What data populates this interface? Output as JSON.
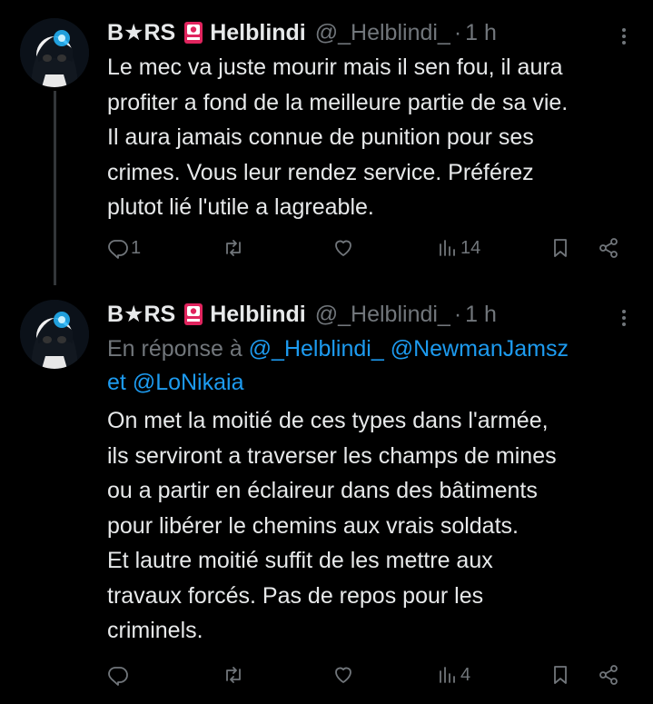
{
  "colors": {
    "background": "#000000",
    "text": "#e7e9ea",
    "muted": "#71767b",
    "link": "#1d9bf0",
    "thread_line": "#333639"
  },
  "tweets": [
    {
      "display_name": "B★RS",
      "badge_icon": "red-flag-icon",
      "name2": "Helblindi",
      "handle": "@_Helblindi_",
      "dot": "·",
      "time": "1 h",
      "lines": [
        "Le mec va juste mourir mais il sen fou, il aura",
        "profiter a fond de la meilleure partie de sa vie.",
        "Il aura jamais connue de punition pour ses",
        "crimes. Vous leur rendez service. Préférez",
        "plutot lié l'utile a lagreable."
      ],
      "reply_count": "1",
      "retweet_count": "",
      "like_count": "",
      "views": "14"
    },
    {
      "display_name": "B★RS",
      "badge_icon": "red-flag-icon",
      "name2": "Helblindi",
      "handle": "@_Helblindi_",
      "dot": "·",
      "time": "1 h",
      "reply_prefix": "En réponse à",
      "reply_mention1": "@_Helblindi_",
      "reply_mention2": "@NewmanJamsz",
      "reply_and": "et",
      "reply_mention3": "@LoNikaia",
      "lines": [
        "On met la moitié de ces types dans l'armée,",
        "ils serviront a traverser les champs de mines",
        "ou a partir en éclaireur dans des bâtiments",
        "pour libérer le chemins aux vrais soldats.",
        "Et lautre moitié suffit de les mettre aux",
        "travaux forcés. Pas de repos pour les",
        "criminels."
      ],
      "reply_count": "",
      "retweet_count": "",
      "like_count": "",
      "views": "4"
    }
  ]
}
